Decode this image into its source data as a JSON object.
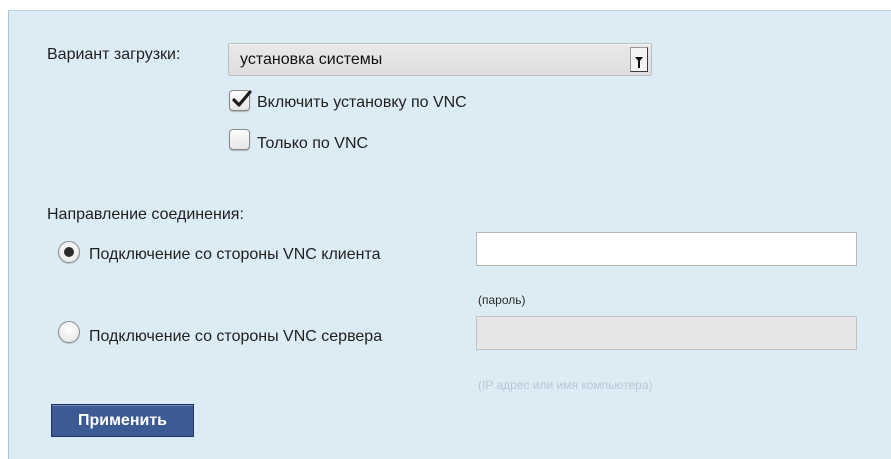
{
  "boot": {
    "label": "Вариант загрузки:",
    "selected": "установка системы"
  },
  "options": {
    "enable_vnc": {
      "label": "Включить установку по VNC",
      "checked": true
    },
    "vnc_only": {
      "label": "Только по VNC",
      "checked": false
    }
  },
  "connection": {
    "heading": "Направление соединения:",
    "client_option": {
      "label": "Подключение со стороны VNC клиента",
      "selected": true
    },
    "server_option": {
      "label": "Подключение со стороны VNC сервера",
      "selected": false
    },
    "password_value": "",
    "password_hint": "(пароль)",
    "host_value": "",
    "host_hint": "(IP адрес или имя компьютера)"
  },
  "apply_label": "Применить",
  "icons": {
    "dropdown": "chevron-down-icon",
    "checkmark": "checkmark-icon"
  },
  "colors": {
    "panel_bg": "#dcecf5",
    "button_bg": "#3c5a94",
    "button_text": "#ffffff"
  }
}
